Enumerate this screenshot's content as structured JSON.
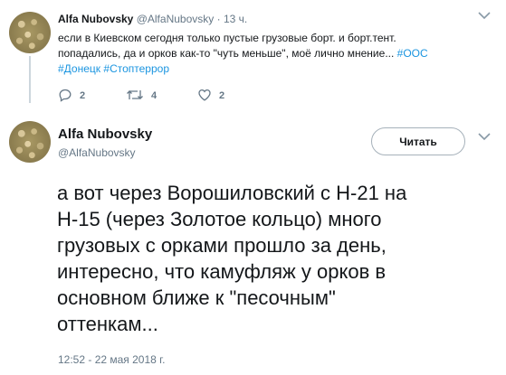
{
  "reply_tweet": {
    "author_name": "Alfa Nubovsky",
    "author_handle": "@AlfaNubovsky",
    "separator": "·",
    "time": "13 ч.",
    "text_line1": "если в Киевском сегодня только пустые грузовые борт. и борт.тент.",
    "text_line2_prefix": "попадались, да и орков как-то \"чуть меньше\", моё лично мнение... ",
    "hashtag1": "#ООС",
    "hashtag2": "#Донецк",
    "hashtag3": "#Стоптеррор",
    "replies": "2",
    "retweets": "4",
    "likes": "2"
  },
  "main_tweet": {
    "author_name": "Alfa Nubovsky",
    "author_handle": "@AlfaNubovsky",
    "follow_label": "Читать",
    "line1": "а вот через Ворошиловский с Н-21 на",
    "line2": "Н-15 (через Золотое кольцо) много",
    "line3": "грузовых с орками прошло за день,",
    "line4": "интересно, что камуфляж у орков в",
    "line5": "основном ближе к \"песочным\"",
    "line6": "оттенкам...",
    "timestamp": "12:52 - 22 мая 2018 г."
  }
}
